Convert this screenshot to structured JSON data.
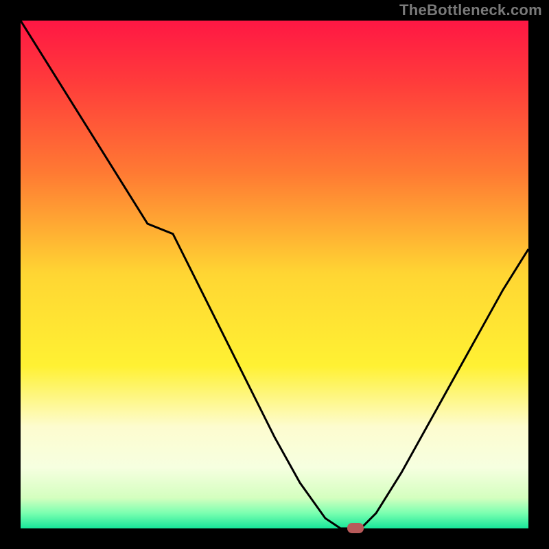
{
  "watermark": "TheBottleneck.com",
  "colors": {
    "bg_black": "#000000",
    "line": "#000000",
    "marker": "#b85a5a",
    "gradient_stops": [
      {
        "offset": 0.0,
        "color": "#ff1744"
      },
      {
        "offset": 0.12,
        "color": "#ff3b3b"
      },
      {
        "offset": 0.3,
        "color": "#ff7a33"
      },
      {
        "offset": 0.5,
        "color": "#ffd633"
      },
      {
        "offset": 0.68,
        "color": "#fff133"
      },
      {
        "offset": 0.8,
        "color": "#fdfccf"
      },
      {
        "offset": 0.88,
        "color": "#f6ffe0"
      },
      {
        "offset": 0.94,
        "color": "#d4ffbf"
      },
      {
        "offset": 0.97,
        "color": "#7affb0"
      },
      {
        "offset": 1.0,
        "color": "#17e69a"
      }
    ]
  },
  "chart_data": {
    "type": "line",
    "title": "",
    "xlabel": "",
    "ylabel": "",
    "x": [
      0.0,
      0.05,
      0.1,
      0.15,
      0.2,
      0.25,
      0.3,
      0.35,
      0.4,
      0.45,
      0.5,
      0.55,
      0.6,
      0.63,
      0.67,
      0.7,
      0.75,
      0.8,
      0.85,
      0.9,
      0.95,
      1.0
    ],
    "values": [
      1.0,
      0.92,
      0.84,
      0.76,
      0.68,
      0.6,
      0.58,
      0.48,
      0.38,
      0.28,
      0.18,
      0.09,
      0.02,
      0.0,
      0.0,
      0.03,
      0.11,
      0.2,
      0.29,
      0.38,
      0.47,
      0.55
    ],
    "xlim": [
      0,
      1
    ],
    "ylim": [
      0,
      1
    ],
    "floor_y": 0.0,
    "marker": {
      "x": 0.66,
      "y": 0.0
    }
  }
}
